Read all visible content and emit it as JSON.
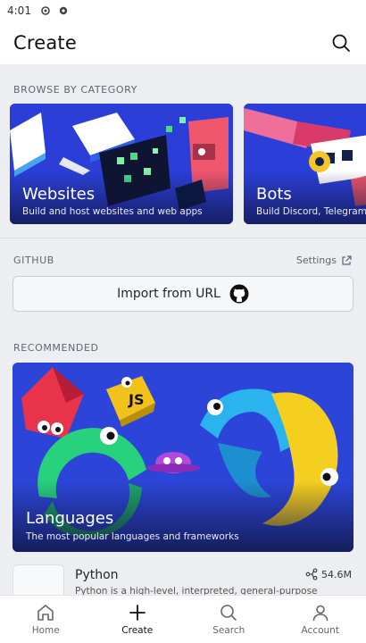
{
  "status_bar": {
    "time": "4:01"
  },
  "header": {
    "title": "Create"
  },
  "sections": {
    "browse_label": "BROWSE BY CATEGORY",
    "github_label": "GITHUB",
    "recommended_label": "RECOMMENDED"
  },
  "categories": [
    {
      "title": "Websites",
      "subtitle": "Build and host websites and web apps"
    },
    {
      "title": "Bots",
      "subtitle": "Build Discord, Telegram, and Slack bots"
    }
  ],
  "github": {
    "settings_label": "Settings",
    "import_label": "Import from URL"
  },
  "banner": {
    "title": "Languages",
    "subtitle": "The most popular languages and frameworks"
  },
  "python": {
    "name": "Python",
    "description": "Python is a high-level, interpreted, general-purpose",
    "forks": "54.6M"
  },
  "nav": [
    {
      "label": "Home",
      "icon": "home-icon"
    },
    {
      "label": "Create",
      "icon": "plus-icon"
    },
    {
      "label": "Search",
      "icon": "search-icon"
    },
    {
      "label": "Account",
      "icon": "user-icon"
    }
  ],
  "colors": {
    "accent": "#2c45d8",
    "background": "#eceef1"
  }
}
